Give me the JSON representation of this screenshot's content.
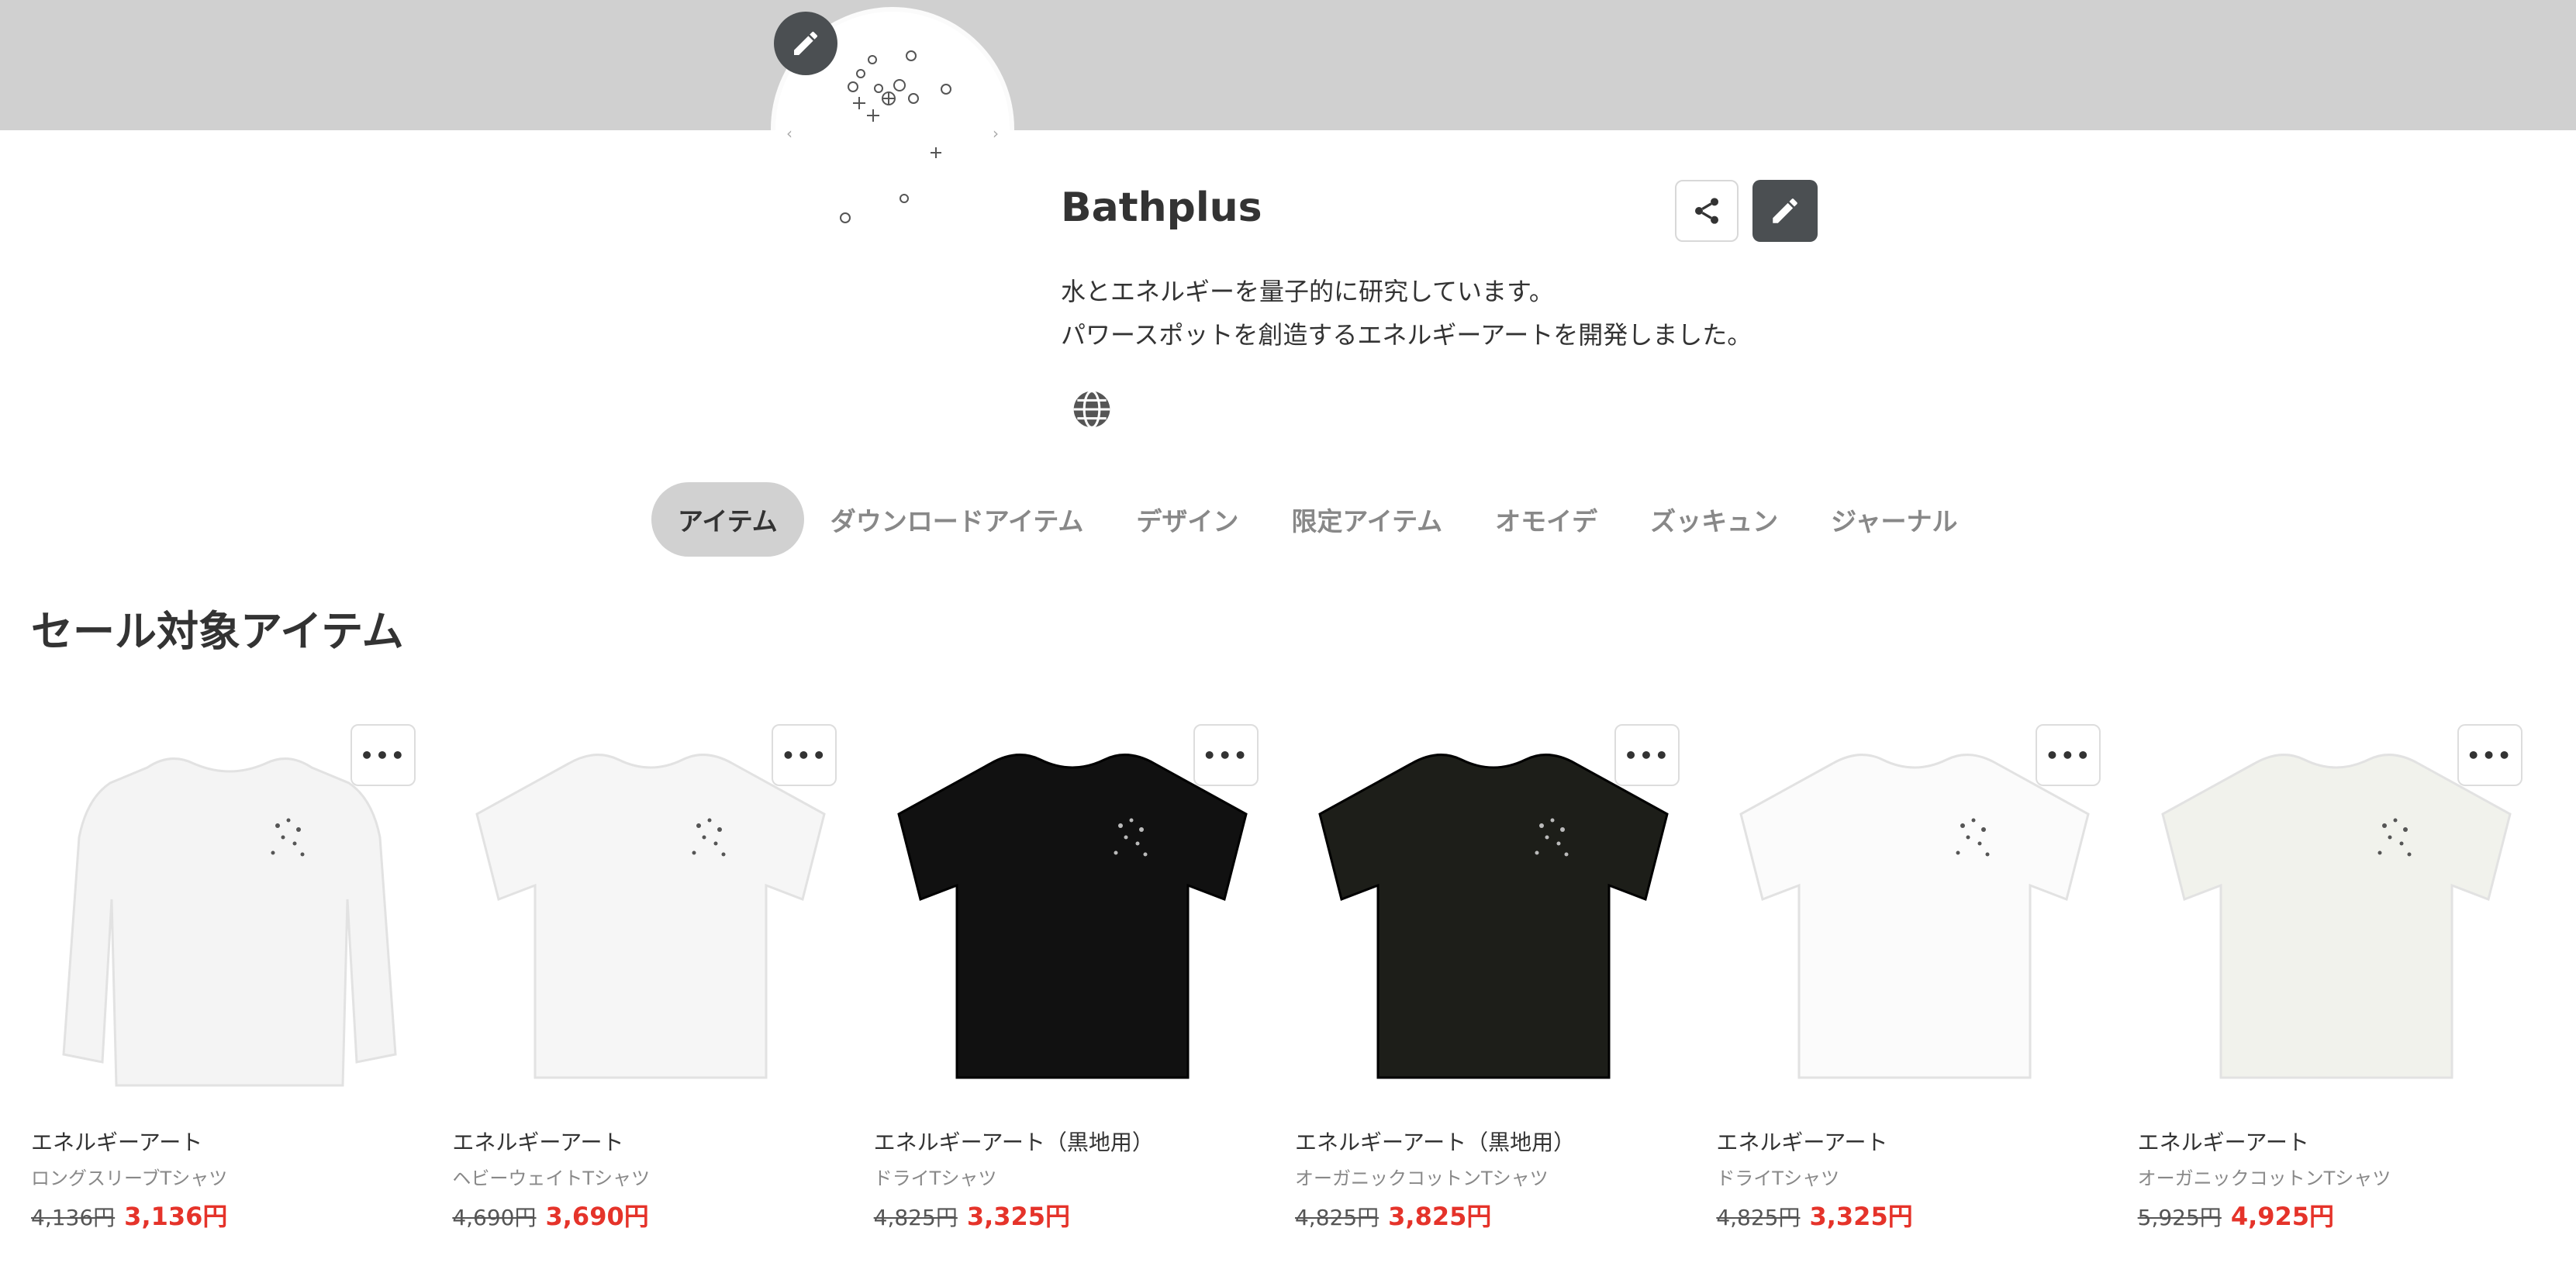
{
  "header": {
    "cover_color": "#d0d0d0"
  },
  "profile": {
    "shop_name": "Bathplus",
    "bio_line1": "水とエネルギーを量子的に研究しています。",
    "bio_line2": "パワースポットを創造するエネルギーアートを開発しました。",
    "avatar_prev": "‹",
    "avatar_next": "›"
  },
  "tabs": [
    {
      "label": "アイテム",
      "active": true
    },
    {
      "label": "ダウンロードアイテム",
      "active": false
    },
    {
      "label": "デザイン",
      "active": false
    },
    {
      "label": "限定アイテム",
      "active": false
    },
    {
      "label": "オモイデ",
      "active": false
    },
    {
      "label": "ズッキュン",
      "active": false
    },
    {
      "label": "ジャーナル",
      "active": false
    }
  ],
  "section": {
    "title": "セール対象アイテム"
  },
  "products": [
    {
      "name": "エネルギーアート",
      "kind": "ロングスリーブTシャツ",
      "old_price": "4,136円",
      "price": "3,136円",
      "shirt": "longsleeve",
      "color": "#f4f4f4"
    },
    {
      "name": "エネルギーアート",
      "kind": "ヘビーウェイトTシャツ",
      "old_price": "4,690円",
      "price": "3,690円",
      "shirt": "tee",
      "color": "#f6f6f6"
    },
    {
      "name": "エネルギーアート（黒地用）",
      "kind": "ドライTシャツ",
      "old_price": "4,825円",
      "price": "3,325円",
      "shirt": "tee",
      "color": "#111111"
    },
    {
      "name": "エネルギーアート（黒地用）",
      "kind": "オーガニックコットンTシャツ",
      "old_price": "4,825円",
      "price": "3,825円",
      "shirt": "tee",
      "color": "#1d1e19"
    },
    {
      "name": "エネルギーアート",
      "kind": "ドライTシャツ",
      "old_price": "4,825円",
      "price": "3,325円",
      "shirt": "tee",
      "color": "#fbfbfb"
    },
    {
      "name": "エネルギーアート",
      "kind": "オーガニックコットンTシャツ",
      "old_price": "5,925円",
      "price": "4,925円",
      "shirt": "tee",
      "color": "#f1f2ec"
    }
  ],
  "more_label": "•••",
  "colors": {
    "sale": "#e5332a",
    "button_dark": "#4b4f52",
    "tab_active": "#d1d1d1"
  }
}
